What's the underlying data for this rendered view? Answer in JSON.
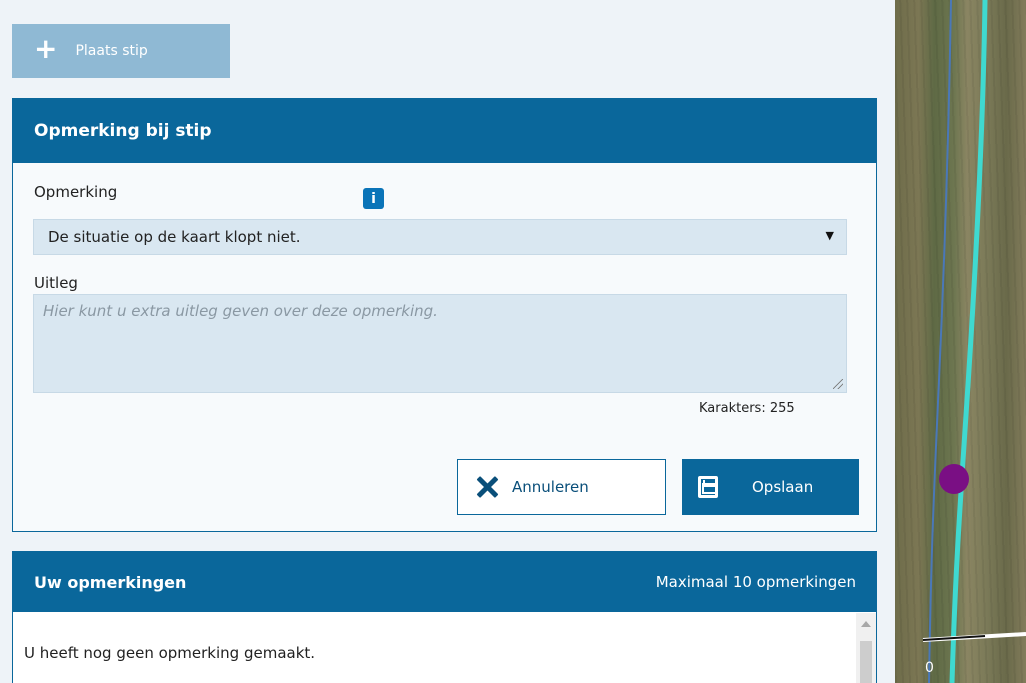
{
  "toolbar": {
    "place_label": "Plaats stip"
  },
  "form": {
    "title": "Opmerking bij stip",
    "remark_label": "Opmerking",
    "remark_value": "De situatie op de kaart klopt niet.",
    "explanation_label": "Uitleg",
    "explanation_placeholder": "Hier kunt u extra uitleg geven over deze opmerking.",
    "char_count_label": "Karakters:",
    "char_count_value": "255",
    "cancel_label": "Annuleren",
    "save_label": "Opslaan",
    "info_icon_text": "i"
  },
  "remarks": {
    "title": "Uw opmerkingen",
    "max_label": "Maximaal 10 opmerkingen",
    "empty_text": "U heeft nog geen opmerking gemaakt."
  },
  "map": {
    "scale_label": "0",
    "marker_color": "#7a0f84",
    "line_color": "#3fd9d0"
  },
  "colors": {
    "accent": "#0a679b",
    "field_bg": "#d9e7f1",
    "place_button_bg": "#8fb9d4"
  },
  "icons": [
    "plus-icon",
    "info-icon",
    "chevron-down-icon",
    "close-icon",
    "save-icon"
  ]
}
